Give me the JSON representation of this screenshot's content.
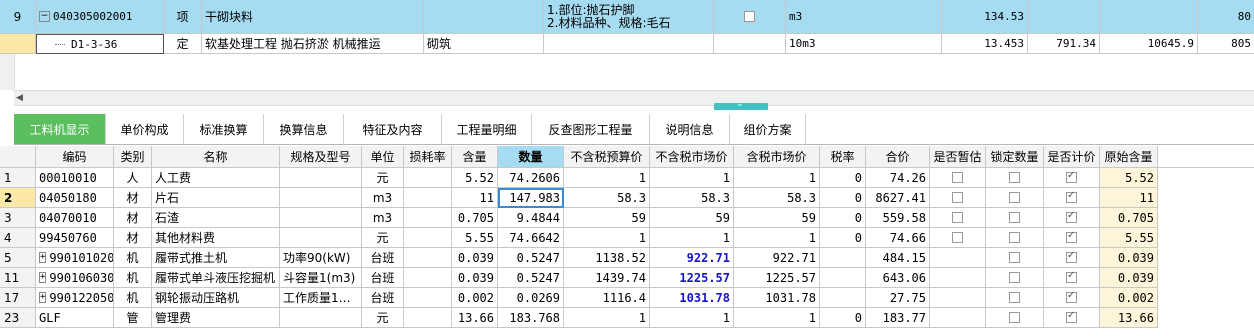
{
  "top_rows": [
    {
      "num": "9",
      "code": "040305002001",
      "type": "项",
      "name": "干砌块料",
      "spec": "",
      "feature_lines": [
        "1.部位:抛石护脚",
        "2.材料品种、规格:毛石"
      ],
      "unit": "m3",
      "qty": "134.53",
      "price": "",
      "total": "",
      "extra": "80"
    },
    {
      "num": "",
      "code": "D1-3-36",
      "type": "定",
      "name": "软基处理工程 抛石挤淤 机械推运",
      "spec": "砌筑",
      "feature_lines": [
        "",
        ""
      ],
      "unit": "10m3",
      "qty": "13.453",
      "price": "791.34",
      "total": "10645.9",
      "extra": "805"
    }
  ],
  "tabs": [
    "工料机显示",
    "单价构成",
    "标准换算",
    "换算信息",
    "特征及内容",
    "工程量明细",
    "反查图形工程量",
    "说明信息",
    "组价方案"
  ],
  "columns": [
    "编码",
    "类别",
    "名称",
    "规格及型号",
    "单位",
    "损耗率",
    "含量",
    "数量",
    "不含税预算价",
    "不含税市场价",
    "含税市场价",
    "税率",
    "合价",
    "是否暂估",
    "锁定数量",
    "是否计价",
    "原始含量"
  ],
  "rows": [
    {
      "rn": "1",
      "code": "00010010",
      "cat": "人",
      "name": "人工费",
      "spec": "",
      "unit": "元",
      "loss": "",
      "content": "5.52",
      "qty": "74.2606",
      "budget": "1",
      "market": "1",
      "tax_market": "1",
      "rate": "0",
      "amount": "74.26",
      "est": false,
      "lock": false,
      "priced": true,
      "orig": "5.52",
      "expand": false
    },
    {
      "rn": "2",
      "code": "04050180",
      "cat": "材",
      "name": "片石",
      "spec": "",
      "unit": "m3",
      "loss": "",
      "content": "11",
      "qty": "147.983",
      "budget": "58.3",
      "market": "58.3",
      "tax_market": "58.3",
      "rate": "0",
      "amount": "8627.41",
      "est": false,
      "lock": false,
      "priced": true,
      "orig": "11",
      "expand": false
    },
    {
      "rn": "3",
      "code": "04070010",
      "cat": "材",
      "name": "石渣",
      "spec": "",
      "unit": "m3",
      "loss": "",
      "content": "0.705",
      "qty": "9.4844",
      "budget": "59",
      "market": "59",
      "tax_market": "59",
      "rate": "0",
      "amount": "559.58",
      "est": false,
      "lock": false,
      "priced": true,
      "orig": "0.705",
      "expand": false
    },
    {
      "rn": "4",
      "code": "99450760",
      "cat": "材",
      "name": "其他材料费",
      "spec": "",
      "unit": "元",
      "loss": "",
      "content": "5.55",
      "qty": "74.6642",
      "budget": "1",
      "market": "1",
      "tax_market": "1",
      "rate": "0",
      "amount": "74.66",
      "est": false,
      "lock": false,
      "priced": true,
      "orig": "5.55",
      "expand": false
    },
    {
      "rn": "5",
      "code": "990101020",
      "cat": "机",
      "name": "履带式推土机",
      "spec": "功率90(kW)",
      "unit": "台班",
      "loss": "",
      "content": "0.039",
      "qty": "0.5247",
      "budget": "1138.52",
      "market": "922.71",
      "tax_market": "922.71",
      "rate": "",
      "amount": "484.15",
      "est": null,
      "lock": false,
      "priced": true,
      "orig": "0.039",
      "expand": true
    },
    {
      "rn": "11",
      "code": "990106030",
      "cat": "机",
      "name": "履带式单斗液压挖掘机",
      "spec": "斗容量1(m3)",
      "unit": "台班",
      "loss": "",
      "content": "0.039",
      "qty": "0.5247",
      "budget": "1439.74",
      "market": "1225.57",
      "tax_market": "1225.57",
      "rate": "",
      "amount": "643.06",
      "est": null,
      "lock": false,
      "priced": true,
      "orig": "0.039",
      "expand": true
    },
    {
      "rn": "17",
      "code": "990122050",
      "cat": "机",
      "name": "钢轮振动压路机",
      "spec": "工作质量1…",
      "unit": "台班",
      "loss": "",
      "content": "0.002",
      "qty": "0.0269",
      "budget": "1116.4",
      "market": "1031.78",
      "tax_market": "1031.78",
      "rate": "",
      "amount": "27.75",
      "est": null,
      "lock": false,
      "priced": true,
      "orig": "0.002",
      "expand": true
    },
    {
      "rn": "23",
      "code": "GLF",
      "cat": "管",
      "name": "管理费",
      "spec": "",
      "unit": "元",
      "loss": "",
      "content": "13.66",
      "qty": "183.768",
      "budget": "1",
      "market": "1",
      "tax_market": "1",
      "rate": "0",
      "amount": "183.77",
      "est": null,
      "lock": false,
      "priced": true,
      "orig": "13.66",
      "expand": false
    }
  ]
}
